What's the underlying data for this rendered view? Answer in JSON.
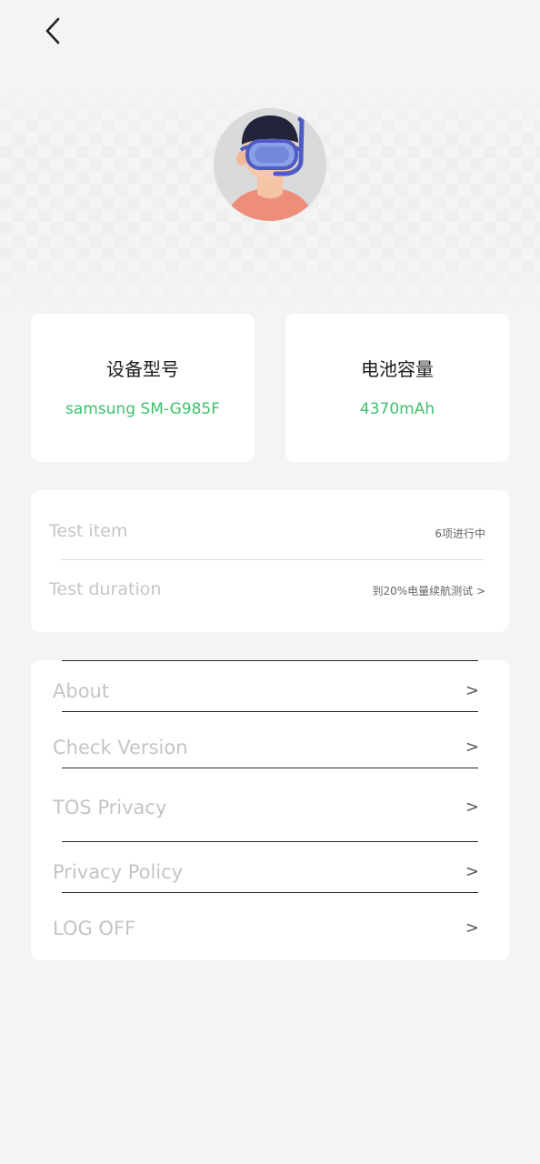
{
  "nav": {
    "back_icon": "chevron-left-icon"
  },
  "avatar": {
    "icon": "user-avatar-with-diving-mask"
  },
  "device_info": [
    {
      "title": "设备型号",
      "value": "samsung SM-G985F"
    },
    {
      "title": "电池容量",
      "value": "4370mAh"
    }
  ],
  "test_info": {
    "item_label": "Test item",
    "item_value": "6项进行中",
    "duration_label": "Test duration",
    "duration_value": "到20%电量续航测试 >"
  },
  "menu": {
    "items": [
      {
        "label": "About",
        "arrow": ">"
      },
      {
        "label": "Check Version",
        "arrow": ">"
      },
      {
        "label": "TOS Privacy",
        "arrow": ">"
      },
      {
        "label": "Privacy Policy",
        "arrow": ">"
      },
      {
        "label": "LOG OFF",
        "arrow": ">"
      }
    ]
  },
  "colors": {
    "accent_green": "#3fc06d",
    "page_background": "#f4f4f4",
    "card_background": "#ffffff"
  }
}
